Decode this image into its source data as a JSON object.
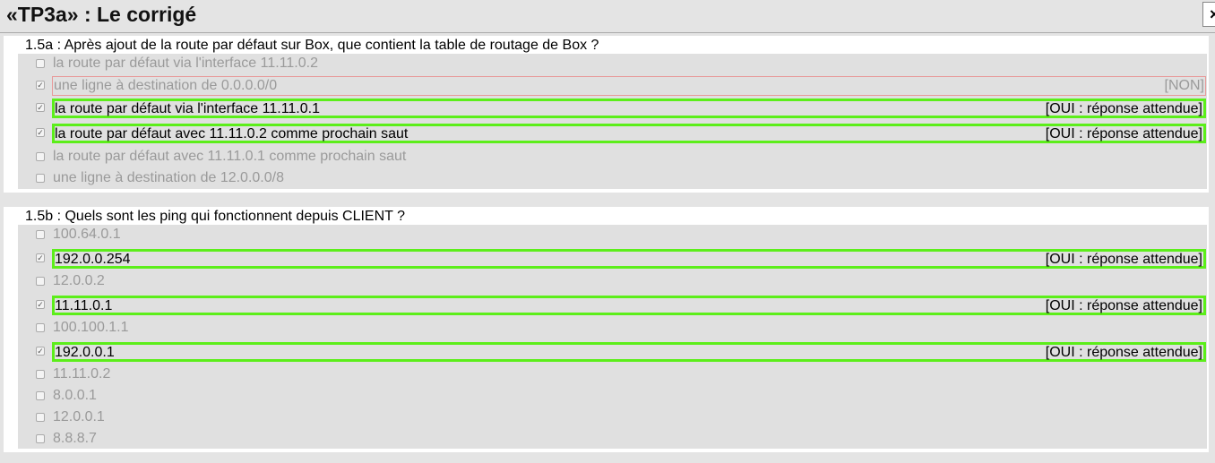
{
  "window": {
    "title": "«TP3a» : Le corrigé",
    "close_label": "×"
  },
  "questions": [
    {
      "title": "1.5a : Après ajout de la route par défaut sur Box, que contient la table de routage de Box ?",
      "choices": [
        {
          "label": "la route par défaut via l'interface 11.11.0.2",
          "checked": false,
          "verdict": ""
        },
        {
          "label": "une ligne à destination de 0.0.0.0/0",
          "checked": true,
          "verdict": "[NON]"
        },
        {
          "label": "la route par défaut via l'interface 11.11.0.1",
          "checked": true,
          "verdict": "[OUI : réponse attendue]"
        },
        {
          "label": "la route par défaut avec 11.11.0.2 comme prochain saut",
          "checked": true,
          "verdict": "[OUI : réponse attendue]"
        },
        {
          "label": "la route par défaut avec 11.11.0.1 comme prochain saut",
          "checked": false,
          "verdict": ""
        },
        {
          "label": "une ligne à destination de 12.0.0.0/8",
          "checked": false,
          "verdict": ""
        }
      ]
    },
    {
      "title": "1.5b : Quels sont les ping qui fonctionnent depuis CLIENT ?",
      "choices": [
        {
          "label": "100.64.0.1",
          "checked": false,
          "verdict": ""
        },
        {
          "label": "192.0.0.254",
          "checked": true,
          "verdict": "[OUI : réponse attendue]"
        },
        {
          "label": "12.0.0.2",
          "checked": false,
          "verdict": ""
        },
        {
          "label": "11.11.0.1",
          "checked": true,
          "verdict": "[OUI : réponse attendue]"
        },
        {
          "label": "100.100.1.1",
          "checked": false,
          "verdict": ""
        },
        {
          "label": "192.0.0.1",
          "checked": true,
          "verdict": "[OUI : réponse attendue]"
        },
        {
          "label": "11.11.0.2",
          "checked": false,
          "verdict": ""
        },
        {
          "label": "8.0.0.1",
          "checked": false,
          "verdict": ""
        },
        {
          "label": "12.0.0.1",
          "checked": false,
          "verdict": ""
        },
        {
          "label": "8.8.8.7",
          "checked": false,
          "verdict": ""
        }
      ]
    }
  ]
}
